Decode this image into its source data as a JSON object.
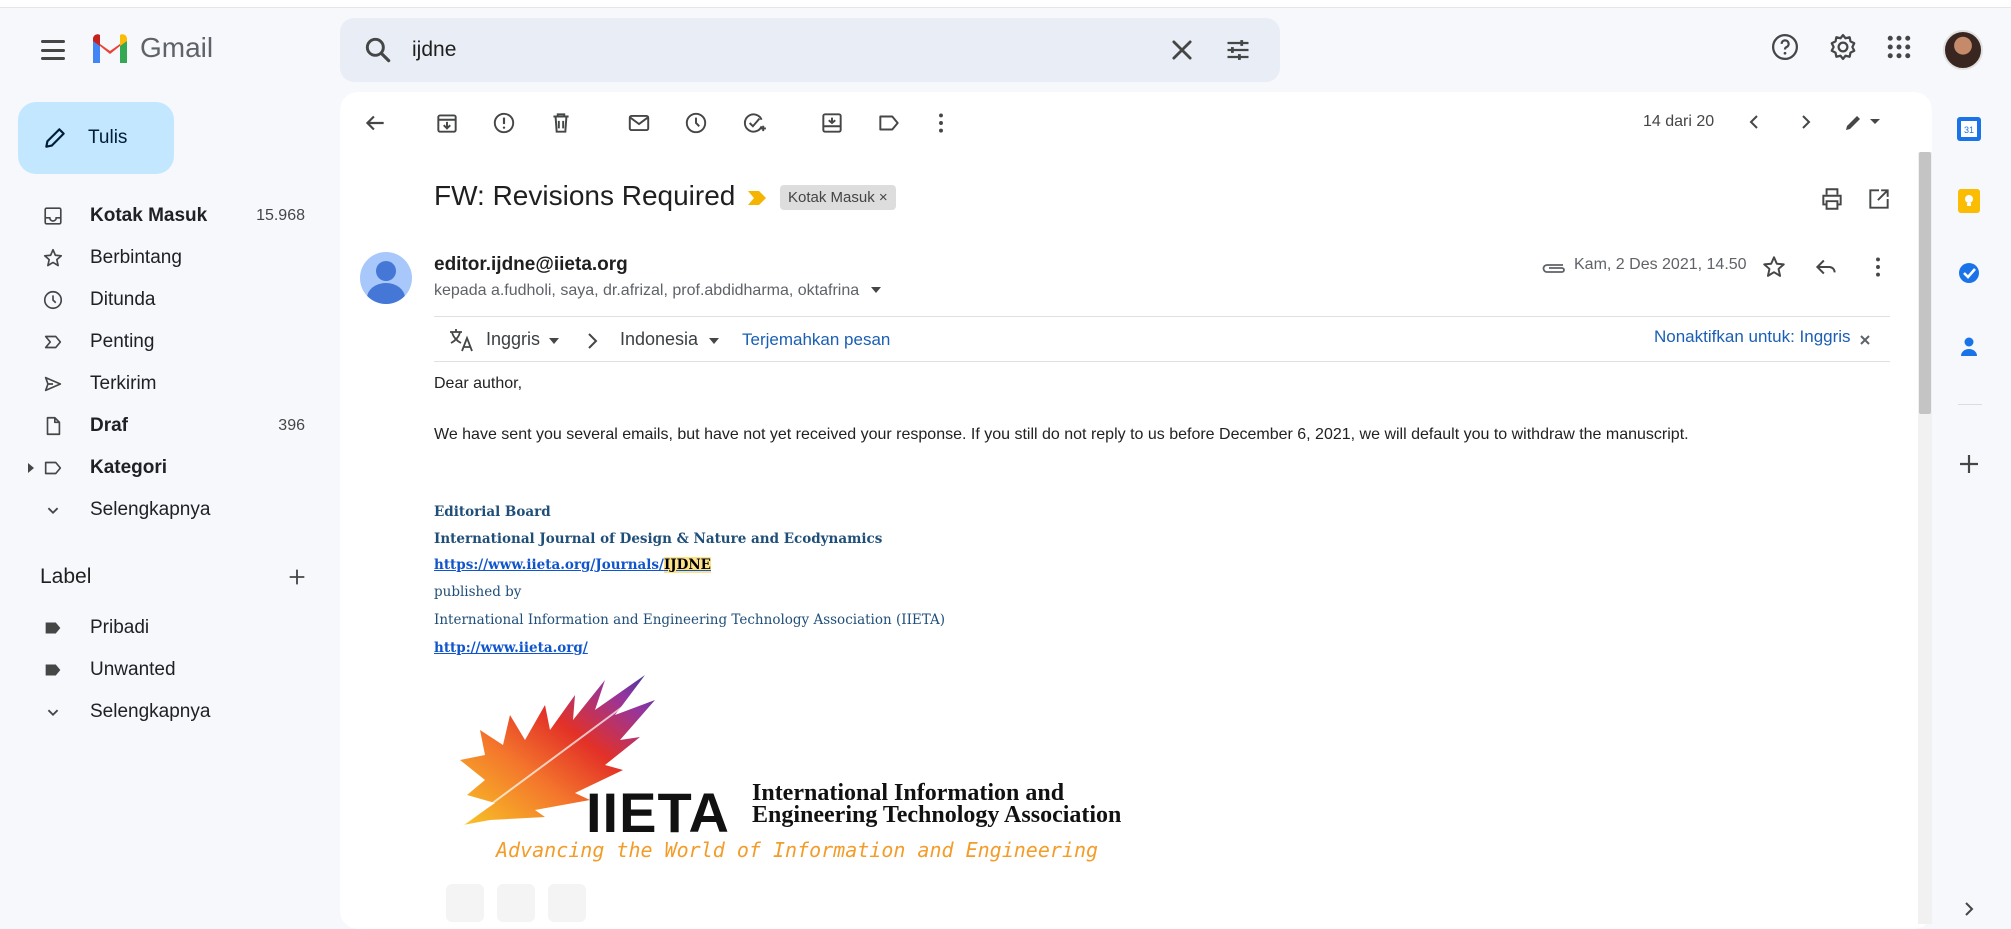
{
  "app": {
    "name": "Gmail"
  },
  "search": {
    "query": "ijdne"
  },
  "compose": {
    "label": "Tulis"
  },
  "nav": [
    {
      "label": "Kotak Masuk",
      "count": "15.968",
      "bold": true
    },
    {
      "label": "Berbintang",
      "count": ""
    },
    {
      "label": "Ditunda",
      "count": ""
    },
    {
      "label": "Penting",
      "count": ""
    },
    {
      "label": "Terkirim",
      "count": ""
    },
    {
      "label": "Draf",
      "count": "396",
      "bold": true
    },
    {
      "label": "Kategori",
      "count": "",
      "bold": true
    },
    {
      "label": "Selengkapnya",
      "count": ""
    }
  ],
  "labels": {
    "title": "Label",
    "items": [
      {
        "label": "Pribadi"
      },
      {
        "label": "Unwanted"
      },
      {
        "label": "Selengkapnya"
      }
    ]
  },
  "toolbar": {
    "pagination": "14 dari 20"
  },
  "email": {
    "subject": "FW: Revisions Required",
    "label_chip": "Kotak Masuk",
    "chip_close": "×",
    "sender": "editor.ijdne@iieta.org",
    "recipients": "kepada a.fudholi, saya, dr.afrizal, prof.abdidharma, oktafrina",
    "date": "Kam, 2 Des 2021, 14.50",
    "translate": {
      "from": "Inggris",
      "to": "Indonesia",
      "action": "Terjemahkan pesan",
      "disable": "Nonaktifkan untuk: Inggris"
    },
    "greeting": "Dear author,",
    "body": "We have sent you several emails, but have not yet received your response. If you still do not reply to us before December 6, 2021, we will default you to withdraw the manuscript.",
    "signature": {
      "board": "Editorial Board",
      "journal": "International Journal of Design & Nature and Ecodynamics",
      "journal_url_prefix": "https://www.iieta.org/Journals/",
      "journal_url_highlight": "IJDNE",
      "published_by": "published by",
      "association": "International Information and Engineering Technology Association (IIETA)",
      "site_url": "http://www.iieta.org/"
    },
    "logo": {
      "acronym": "IIETA",
      "name_line1": "International Information and",
      "name_line2": "Engineering Technology Association",
      "tagline": "Advancing the World of Information and Engineering"
    }
  }
}
